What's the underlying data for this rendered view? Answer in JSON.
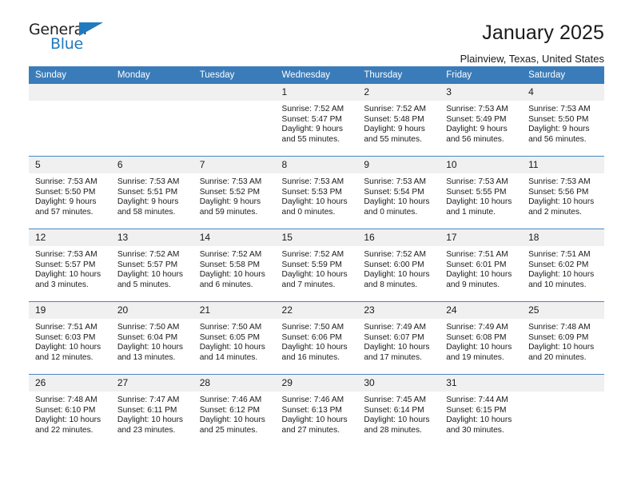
{
  "brand": {
    "name_part1": "General",
    "name_part2": "Blue",
    "accent_color": "#1f7ac0"
  },
  "header": {
    "title": "January 2025",
    "location": "Plainview, Texas, United States"
  },
  "calendar": {
    "header_bg_color": "#3a7cb9",
    "daynum_bg_color": "#f0f0f0",
    "weekday_headers": [
      "Sunday",
      "Monday",
      "Tuesday",
      "Wednesday",
      "Thursday",
      "Friday",
      "Saturday"
    ],
    "labels": {
      "sunrise_prefix": "Sunrise:",
      "sunset_prefix": "Sunset:",
      "daylight_prefix": "Daylight:"
    },
    "weeks": [
      [
        {
          "day": "",
          "empty": true
        },
        {
          "day": "",
          "empty": true
        },
        {
          "day": "",
          "empty": true
        },
        {
          "day": "1",
          "sunrise": "Sunrise: 7:52 AM",
          "sunset": "Sunset: 5:47 PM",
          "daylight1": "Daylight: 9 hours",
          "daylight2": "and 55 minutes."
        },
        {
          "day": "2",
          "sunrise": "Sunrise: 7:52 AM",
          "sunset": "Sunset: 5:48 PM",
          "daylight1": "Daylight: 9 hours",
          "daylight2": "and 55 minutes."
        },
        {
          "day": "3",
          "sunrise": "Sunrise: 7:53 AM",
          "sunset": "Sunset: 5:49 PM",
          "daylight1": "Daylight: 9 hours",
          "daylight2": "and 56 minutes."
        },
        {
          "day": "4",
          "sunrise": "Sunrise: 7:53 AM",
          "sunset": "Sunset: 5:50 PM",
          "daylight1": "Daylight: 9 hours",
          "daylight2": "and 56 minutes."
        }
      ],
      [
        {
          "day": "5",
          "sunrise": "Sunrise: 7:53 AM",
          "sunset": "Sunset: 5:50 PM",
          "daylight1": "Daylight: 9 hours",
          "daylight2": "and 57 minutes."
        },
        {
          "day": "6",
          "sunrise": "Sunrise: 7:53 AM",
          "sunset": "Sunset: 5:51 PM",
          "daylight1": "Daylight: 9 hours",
          "daylight2": "and 58 minutes."
        },
        {
          "day": "7",
          "sunrise": "Sunrise: 7:53 AM",
          "sunset": "Sunset: 5:52 PM",
          "daylight1": "Daylight: 9 hours",
          "daylight2": "and 59 minutes."
        },
        {
          "day": "8",
          "sunrise": "Sunrise: 7:53 AM",
          "sunset": "Sunset: 5:53 PM",
          "daylight1": "Daylight: 10 hours",
          "daylight2": "and 0 minutes."
        },
        {
          "day": "9",
          "sunrise": "Sunrise: 7:53 AM",
          "sunset": "Sunset: 5:54 PM",
          "daylight1": "Daylight: 10 hours",
          "daylight2": "and 0 minutes."
        },
        {
          "day": "10",
          "sunrise": "Sunrise: 7:53 AM",
          "sunset": "Sunset: 5:55 PM",
          "daylight1": "Daylight: 10 hours",
          "daylight2": "and 1 minute."
        },
        {
          "day": "11",
          "sunrise": "Sunrise: 7:53 AM",
          "sunset": "Sunset: 5:56 PM",
          "daylight1": "Daylight: 10 hours",
          "daylight2": "and 2 minutes."
        }
      ],
      [
        {
          "day": "12",
          "sunrise": "Sunrise: 7:53 AM",
          "sunset": "Sunset: 5:57 PM",
          "daylight1": "Daylight: 10 hours",
          "daylight2": "and 3 minutes."
        },
        {
          "day": "13",
          "sunrise": "Sunrise: 7:52 AM",
          "sunset": "Sunset: 5:57 PM",
          "daylight1": "Daylight: 10 hours",
          "daylight2": "and 5 minutes."
        },
        {
          "day": "14",
          "sunrise": "Sunrise: 7:52 AM",
          "sunset": "Sunset: 5:58 PM",
          "daylight1": "Daylight: 10 hours",
          "daylight2": "and 6 minutes."
        },
        {
          "day": "15",
          "sunrise": "Sunrise: 7:52 AM",
          "sunset": "Sunset: 5:59 PM",
          "daylight1": "Daylight: 10 hours",
          "daylight2": "and 7 minutes."
        },
        {
          "day": "16",
          "sunrise": "Sunrise: 7:52 AM",
          "sunset": "Sunset: 6:00 PM",
          "daylight1": "Daylight: 10 hours",
          "daylight2": "and 8 minutes."
        },
        {
          "day": "17",
          "sunrise": "Sunrise: 7:51 AM",
          "sunset": "Sunset: 6:01 PM",
          "daylight1": "Daylight: 10 hours",
          "daylight2": "and 9 minutes."
        },
        {
          "day": "18",
          "sunrise": "Sunrise: 7:51 AM",
          "sunset": "Sunset: 6:02 PM",
          "daylight1": "Daylight: 10 hours",
          "daylight2": "and 10 minutes."
        }
      ],
      [
        {
          "day": "19",
          "sunrise": "Sunrise: 7:51 AM",
          "sunset": "Sunset: 6:03 PM",
          "daylight1": "Daylight: 10 hours",
          "daylight2": "and 12 minutes."
        },
        {
          "day": "20",
          "sunrise": "Sunrise: 7:50 AM",
          "sunset": "Sunset: 6:04 PM",
          "daylight1": "Daylight: 10 hours",
          "daylight2": "and 13 minutes."
        },
        {
          "day": "21",
          "sunrise": "Sunrise: 7:50 AM",
          "sunset": "Sunset: 6:05 PM",
          "daylight1": "Daylight: 10 hours",
          "daylight2": "and 14 minutes."
        },
        {
          "day": "22",
          "sunrise": "Sunrise: 7:50 AM",
          "sunset": "Sunset: 6:06 PM",
          "daylight1": "Daylight: 10 hours",
          "daylight2": "and 16 minutes."
        },
        {
          "day": "23",
          "sunrise": "Sunrise: 7:49 AM",
          "sunset": "Sunset: 6:07 PM",
          "daylight1": "Daylight: 10 hours",
          "daylight2": "and 17 minutes."
        },
        {
          "day": "24",
          "sunrise": "Sunrise: 7:49 AM",
          "sunset": "Sunset: 6:08 PM",
          "daylight1": "Daylight: 10 hours",
          "daylight2": "and 19 minutes."
        },
        {
          "day": "25",
          "sunrise": "Sunrise: 7:48 AM",
          "sunset": "Sunset: 6:09 PM",
          "daylight1": "Daylight: 10 hours",
          "daylight2": "and 20 minutes."
        }
      ],
      [
        {
          "day": "26",
          "sunrise": "Sunrise: 7:48 AM",
          "sunset": "Sunset: 6:10 PM",
          "daylight1": "Daylight: 10 hours",
          "daylight2": "and 22 minutes."
        },
        {
          "day": "27",
          "sunrise": "Sunrise: 7:47 AM",
          "sunset": "Sunset: 6:11 PM",
          "daylight1": "Daylight: 10 hours",
          "daylight2": "and 23 minutes."
        },
        {
          "day": "28",
          "sunrise": "Sunrise: 7:46 AM",
          "sunset": "Sunset: 6:12 PM",
          "daylight1": "Daylight: 10 hours",
          "daylight2": "and 25 minutes."
        },
        {
          "day": "29",
          "sunrise": "Sunrise: 7:46 AM",
          "sunset": "Sunset: 6:13 PM",
          "daylight1": "Daylight: 10 hours",
          "daylight2": "and 27 minutes."
        },
        {
          "day": "30",
          "sunrise": "Sunrise: 7:45 AM",
          "sunset": "Sunset: 6:14 PM",
          "daylight1": "Daylight: 10 hours",
          "daylight2": "and 28 minutes."
        },
        {
          "day": "31",
          "sunrise": "Sunrise: 7:44 AM",
          "sunset": "Sunset: 6:15 PM",
          "daylight1": "Daylight: 10 hours",
          "daylight2": "and 30 minutes."
        },
        {
          "day": "",
          "empty": true
        }
      ]
    ]
  }
}
